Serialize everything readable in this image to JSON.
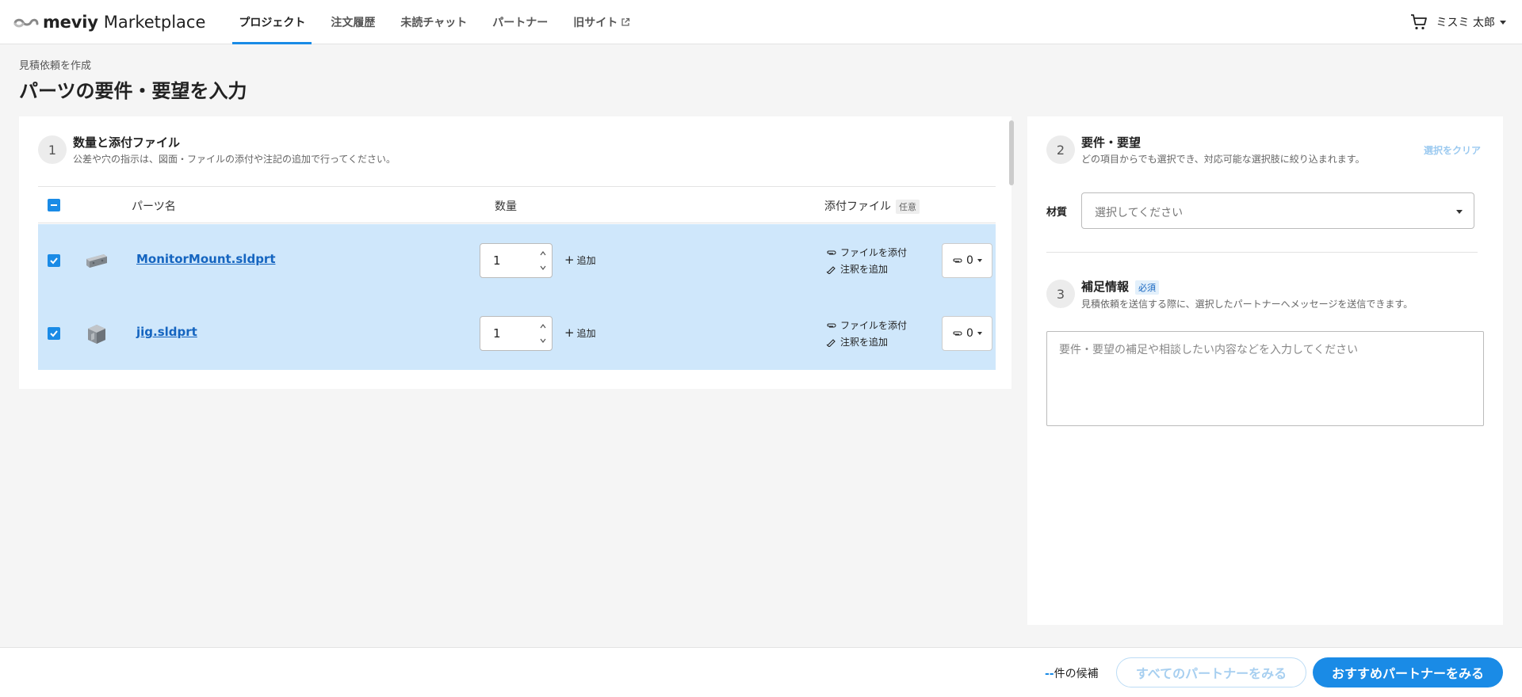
{
  "header": {
    "brand": "meviy",
    "brand_sub": "Marketplace",
    "nav": [
      {
        "label": "プロジェクト",
        "active": true
      },
      {
        "label": "注文履歴",
        "active": false
      },
      {
        "label": "未読チャット",
        "active": false
      },
      {
        "label": "パートナー",
        "active": false
      },
      {
        "label": "旧サイト",
        "active": false
      }
    ],
    "user_name": "ミスミ 太郎",
    "icons": {
      "cart": "cart-icon",
      "external": "external-link-icon"
    }
  },
  "page": {
    "breadcrumb": "見積依頼を作成",
    "title": "パーツの要件・要望を入力"
  },
  "section1": {
    "step": "1",
    "title": "数量と添付ファイル",
    "description": "公差や穴の指示は、図面・ファイルの添付や注記の追加で行ってください。",
    "columns": {
      "part_name": "パーツ名",
      "quantity": "数量",
      "attachments": "添付ファイル",
      "optional": "任意"
    },
    "rows": [
      {
        "name": "MonitorMount.sldprt",
        "quantity": "1",
        "add_label": "追加",
        "attach_label": "ファイルを添付",
        "note_label": "注釈を追加",
        "file_count": "0",
        "checked": true
      },
      {
        "name": "jig.sldprt",
        "quantity": "1",
        "add_label": "追加",
        "attach_label": "ファイルを添付",
        "note_label": "注釈を追加",
        "file_count": "0",
        "checked": true
      }
    ]
  },
  "section2": {
    "step": "2",
    "title": "要件・要望",
    "description": "どの項目からでも選択でき、対応可能な選択肢に絞り込まれます。",
    "clear_label": "選択をクリア",
    "material_label": "材質",
    "material_placeholder": "選択してください"
  },
  "section3": {
    "step": "3",
    "title": "補足情報",
    "required": "必須",
    "description": "見積依頼を送信する際に、選択したパートナーへメッセージを送信できます。",
    "placeholder": "要件・要望の補足や相談したい内容などを入力してください"
  },
  "footer": {
    "candidate_count": "--",
    "candidate_suffix": "件の候補",
    "all_partners_label": "すべてのパートナーをみる",
    "recommended_label": "おすすめパートナーをみる"
  },
  "colors": {
    "accent": "#1a8be6",
    "row_selected": "#cfe7fb",
    "link": "#1565c0"
  }
}
